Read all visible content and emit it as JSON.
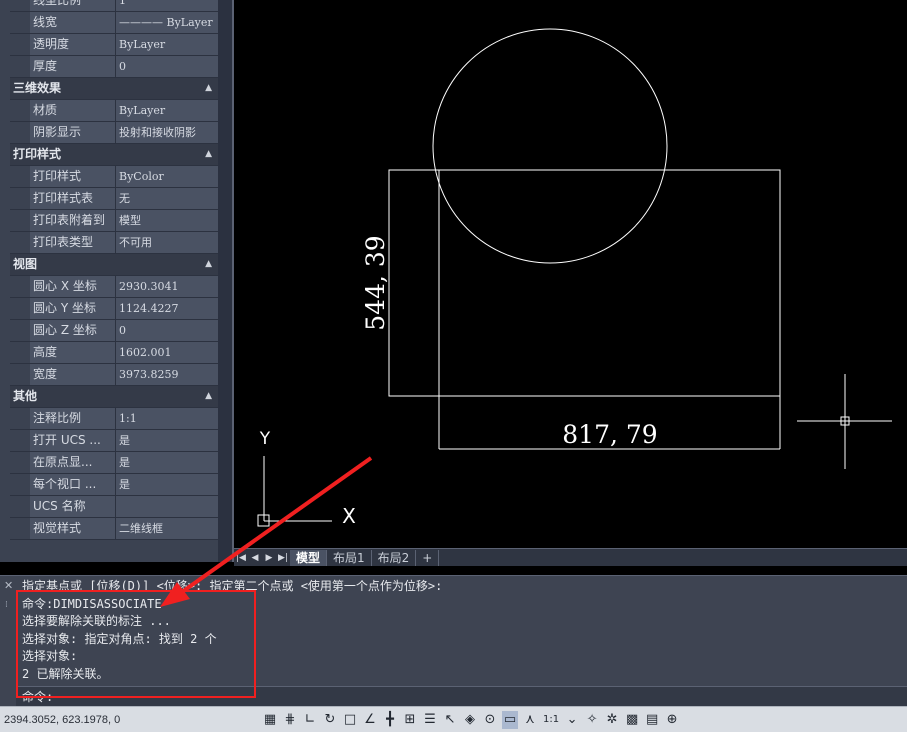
{
  "properties": {
    "top_rows": [
      {
        "name": "线型比例",
        "value": "1"
      },
      {
        "name": "线宽",
        "value": "———— ByLayer"
      },
      {
        "name": "透明度",
        "value": "ByLayer"
      },
      {
        "name": "厚度",
        "value": "0"
      }
    ],
    "groups": [
      {
        "title": "三维效果",
        "rows": [
          {
            "name": "材质",
            "value": "ByLayer"
          },
          {
            "name": "阴影显示",
            "value": "投射和接收阴影"
          }
        ]
      },
      {
        "title": "打印样式",
        "rows": [
          {
            "name": "打印样式",
            "value": "ByColor"
          },
          {
            "name": "打印样式表",
            "value": "无"
          },
          {
            "name": "打印表附着到",
            "value": "模型"
          },
          {
            "name": "打印表类型",
            "value": "不可用"
          }
        ]
      },
      {
        "title": "视图",
        "rows": [
          {
            "name": "圆心 X 坐标",
            "value": "2930.3041"
          },
          {
            "name": "圆心 Y 坐标",
            "value": "1124.4227"
          },
          {
            "name": "圆心 Z 坐标",
            "value": "0"
          },
          {
            "name": "高度",
            "value": "1602.001"
          },
          {
            "name": "宽度",
            "value": "3973.8259"
          }
        ]
      },
      {
        "title": "其他",
        "rows": [
          {
            "name": "注释比例",
            "value": "1:1"
          },
          {
            "name": "打开 UCS ...",
            "value": "是"
          },
          {
            "name": "在原点显...",
            "value": "是"
          },
          {
            "name": "每个视口 ...",
            "value": "是"
          },
          {
            "name": "UCS 名称",
            "value": ""
          },
          {
            "name": "视觉样式",
            "value": "二维线框"
          }
        ]
      }
    ]
  },
  "drawing": {
    "dim_horizontal": "817, 79",
    "dim_vertical": "544, 39",
    "ucs_x_label": "X",
    "ucs_y_label": "Y"
  },
  "tabs": {
    "items": [
      "模型",
      "布局1",
      "布局2"
    ],
    "active": "模型",
    "add_label": "+"
  },
  "command": {
    "history": [
      "指定基点或 [位移(D)] <位移>:  指定第二个点或 <使用第一个点作为位移>:",
      "命令:DIMDISASSOCIATE",
      "选择要解除关联的标注 ...",
      "选择对象: 指定对角点: 找到 2 个",
      "选择对象:",
      "2 已解除关联。"
    ],
    "prompt": "命令:"
  },
  "status": {
    "coords": "2394.3052, 623.1978, 0",
    "scale_label": "1:1",
    "icons": [
      "grid-icon",
      "snap-icon",
      "ortho-icon",
      "polar-icon",
      "osnap-icon",
      "otrack-icon",
      "ducs-icon",
      "dyn-icon",
      "lineweight-icon",
      "transparency-icon",
      "selection-cycling-icon",
      "annotation-icon",
      "workspace-icon",
      "isolate-icon",
      "clean-screen-icon",
      "customize-icon"
    ]
  },
  "colors": {
    "canvas_bg": "#000000",
    "palette_bg": "#3b4251",
    "highlight_box": "#f02020",
    "arrow": "#f02020"
  }
}
